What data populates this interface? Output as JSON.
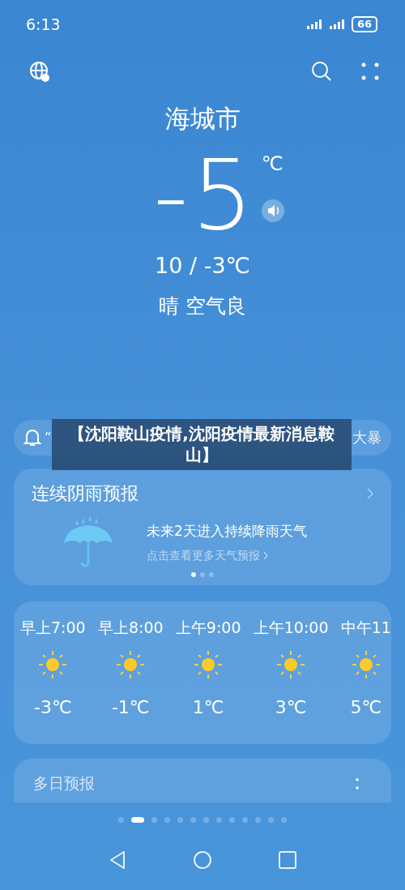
{
  "status_bar": {
    "time": "6:13",
    "battery": "66"
  },
  "city": "海城市",
  "current": {
    "temp": "-5",
    "unit": "℃",
    "range": "10 / -3℃",
    "condition": "晴 空气良"
  },
  "alert": {
    "text_start": "“",
    "text_end": "大暴"
  },
  "overlay_banner": "【沈阳鞍山疫情,沈阳疫情最新消息鞍山】",
  "rain_card": {
    "title": "连续阴雨预报",
    "headline": "未来2天进入持续降雨天气",
    "link": "点击查看更多天气预报",
    "pages": [
      {
        "selected": true
      },
      {
        "selected": false
      },
      {
        "selected": false
      }
    ]
  },
  "hourly": [
    {
      "time": "早上7:00",
      "temp": "-3℃"
    },
    {
      "time": "早上8:00",
      "temp": "-1℃"
    },
    {
      "time": "上午9:00",
      "temp": "1℃"
    },
    {
      "time": "上午10:00",
      "temp": "3℃"
    },
    {
      "time": "中午11",
      "temp": "5℃"
    }
  ],
  "multi_day": {
    "title": "多日预报"
  },
  "city_pages": [
    {
      "selected": false
    },
    {
      "selected": true
    },
    {
      "selected": false
    },
    {
      "selected": false
    },
    {
      "selected": false
    },
    {
      "selected": false
    },
    {
      "selected": false
    },
    {
      "selected": false
    },
    {
      "selected": false
    },
    {
      "selected": false
    },
    {
      "selected": false
    },
    {
      "selected": false
    },
    {
      "selected": false
    }
  ]
}
